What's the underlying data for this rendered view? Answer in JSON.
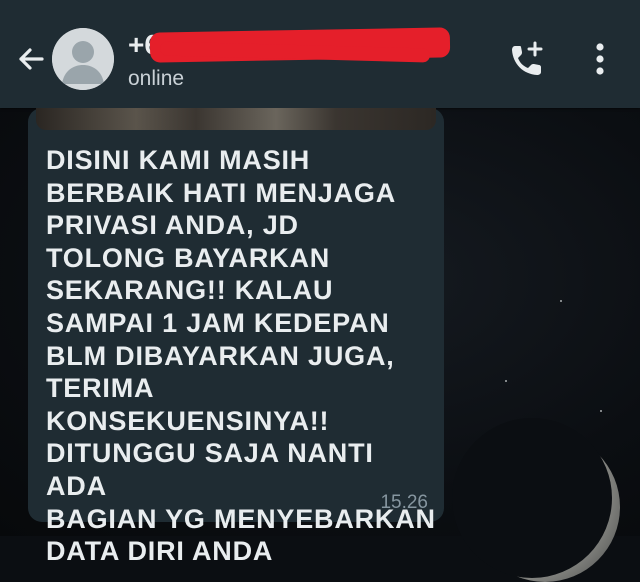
{
  "header": {
    "contact_name": "+6",
    "status": "online",
    "back_icon": "arrow-left-icon",
    "avatar_icon": "default-avatar-icon",
    "call_icon": "add-call-icon",
    "menu_icon": "more-vert-icon"
  },
  "message": {
    "text": "DISINI KAMI MASIH\nBERBAIK HATI MENJAGA\nPRIVASI ANDA, JD\nTOLONG BAYARKAN\nSEKARANG!! KALAU\nSAMPAI 1 JAM KEDEPAN\nBLM DIBAYARKAN JUGA,\nTERIMA KONSEKUENSINYA!!\nDITUNGGU SAJA NANTI ADA\nBAGIAN YG MENYEBARKAN\nDATA DIRI ANDA",
    "time": "15.26"
  },
  "colors": {
    "header_bg": "#1f2c33",
    "bubble_bg": "#1f2c33",
    "text": "#e9edef",
    "meta_text": "#8696a0",
    "redaction": "#e51f2a"
  }
}
